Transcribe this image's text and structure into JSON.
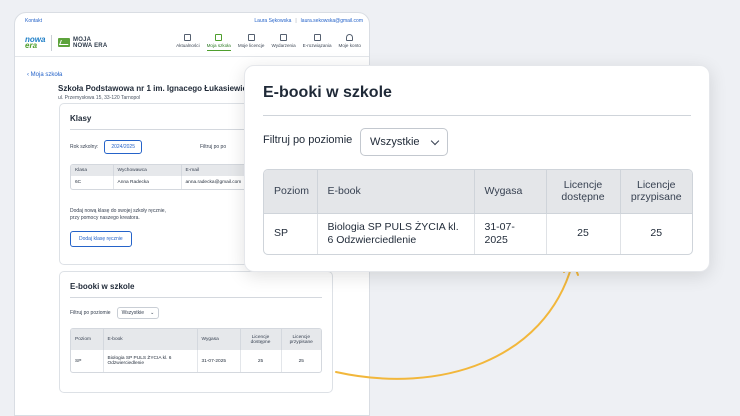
{
  "topbar": {
    "contact": "Kontakt",
    "user_name": "Laura Sękowska",
    "separator": "|",
    "user_email": "laura.sekowska@gmail.com"
  },
  "logo": {
    "nowa_era_top": "nowa",
    "nowa_era_bottom": "era",
    "moja_line1": "MOJA",
    "moja_line2": "NOWA ERA"
  },
  "nav": [
    {
      "label": "Aktualności",
      "icon": "news-icon"
    },
    {
      "label": "Moja szkoła",
      "icon": "school-icon"
    },
    {
      "label": "Moje licencje",
      "icon": "license-icon"
    },
    {
      "label": "Wydarzenia",
      "icon": "calendar-icon"
    },
    {
      "label": "E-rozwiązania",
      "icon": "e-solutions-icon"
    },
    {
      "label": "Moje konto",
      "icon": "account-icon"
    }
  ],
  "back_link": "Moja szkoła",
  "school": {
    "name": "Szkoła Podstawowa nr 1 im. Ignacego Łukasiewicza",
    "address": "ul. Przemysłowa 15, 33-120 Tarnopol"
  },
  "klasy": {
    "title": "Klasy",
    "year_label": "Rok szkolny:",
    "year_value": "2024/2025",
    "filter_label": "Filtruj po po",
    "columns": [
      "Klasa",
      "Wychowawca",
      "E-mail"
    ],
    "rows": [
      {
        "klasa": "6C",
        "wychowawca": "Anna Radecka",
        "email": "anna.radecka@gmail.com"
      }
    ],
    "hint_line1": "Dodaj nową klasę do swojej szkoły ręcznie,",
    "hint_line2": "przy pomocy naszego kreatora.",
    "add_button": "Dodaj klasę ręcznie"
  },
  "ebooks": {
    "title": "E-booki w szkole",
    "filter_label": "Filtruj po poziomie",
    "filter_value": "Wszystkie",
    "columns": [
      "Poziom",
      "E-book",
      "Wygasa",
      "Licencje dostępne",
      "Licencje przypisane"
    ],
    "rows": [
      {
        "poziom": "SP",
        "ebook": "Biologia SP PULS ŻYCIA kl. 6 Odzwierciedlenie",
        "wygasa": "31-07-2025",
        "dostepne": "25",
        "przypisane": "25"
      }
    ]
  },
  "colors": {
    "accent_blue": "#2563c9",
    "brand_green": "#4f9f2e",
    "arrow": "#f2b73b"
  }
}
